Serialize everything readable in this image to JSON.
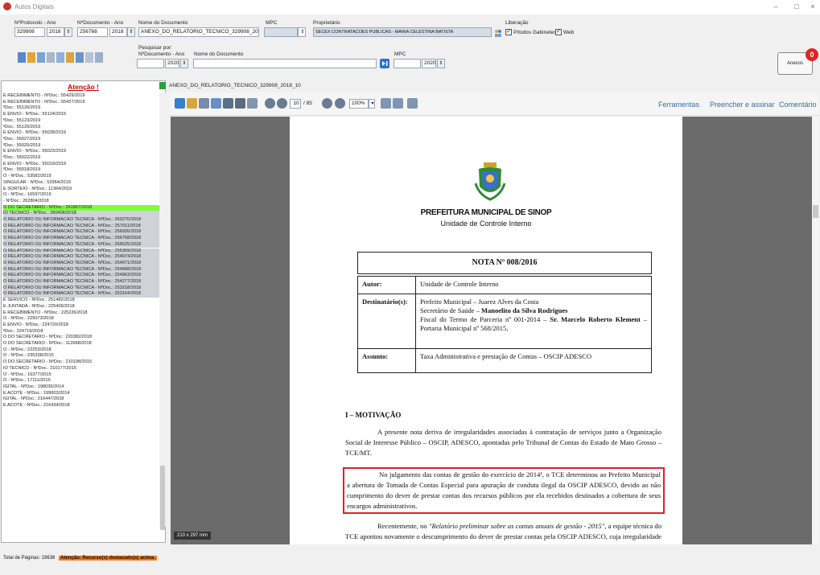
{
  "window": {
    "title": "Autos Digitais",
    "minimize": "–",
    "maximize": "□",
    "close": "×"
  },
  "form": {
    "protocolo_label": "NºProtocolo - Ano",
    "protocolo_value": "329908",
    "protocolo_year": "2018",
    "documento_label": "NºDocumento - Ano",
    "documento_value": "256768",
    "documento_year": "2018",
    "nome_label": "Nome do Documento",
    "nome_value": "ANEXO_DO_RELATORIO_TECNICO_329908_2018_10",
    "mpc_label": "MPC",
    "proprietario_label": "Proprietário",
    "proprietario_value": "SECEX CONTRATACOES PUBLICAS - MARIA CELESTINA BATISTA",
    "liberacao_label": "Liberação",
    "ptodos_label": "P/todos Gabinetes",
    "web_label": "Web",
    "pesquisar_label": "Pesquisar por:",
    "search_doc_label": "NºDocumento - Ano",
    "search_doc_year": "2020",
    "search_nome_label": "Nome do Documento",
    "search_mpc_label": "MPC",
    "search_mpc_year": "2020"
  },
  "anexos": {
    "label": "Anexos",
    "count": "0"
  },
  "left": {
    "header": "Atenção !",
    "items": [
      "E RECEBIMENTO - NºDoc.: 55429/2019",
      "E RECEBIMENTO - NºDoc.: 55427/2019",
      "ºDoc.: 55126/2019",
      "E ENVIO - NºDoc.: 55124/2019",
      "ºDoc.: 55123/2019",
      "ºDoc.: 55120/2019",
      "E ENVIO - NºDoc.: 55028/2019",
      "ºDoc.: 55027/2019",
      "ºDoc.: 55025/2019",
      "E ENVIO - NºDoc.: 55023/2019",
      "ºDoc.: 55022/2019",
      "E ENVIO - NºDoc.: 55019/2019",
      "ºDoc.: 55018/2019",
      "O - NºDoc.: 53582/2019",
      "SINGULAR - NºDoc.: 53364/2019",
      "E SORTEIO - NºDoc.: 11364/2019",
      "O - NºDoc.: 16597/2019",
      "- NºDoc.: 262804/2018",
      "O DO SECRETARIO - NºDoc.: 261867/2018",
      "IO TECNICO - NºDoc.: 260406/2018",
      "O RELATORIO OU INFORMACAO TECNICA - NºDoc.: 260270/2018",
      "O RELATORIO OU INFORMACAO TECNICA - NºDoc.: 257011/2018",
      "O RELATORIO OU INFORMACAO TECNICA - NºDoc.: 256926/2018",
      "O RELATORIO OU INFORMACAO TECNICA - NºDoc.: 256768/2018",
      "O RELATORIO OU INFORMACAO TECNICA - NºDoc.: 256625/2018",
      "O RELATORIO OU INFORMACAO TECNICA - NºDoc.: 255369/2018",
      "O RELATORIO OU INFORMACAO TECNICA - NºDoc.: 254974/2018",
      "O RELATORIO OU INFORMACAO TECNICA - NºDoc.: 254971/2018",
      "O RELATORIO OU INFORMACAO TECNICA - NºDoc.: 254968/2018",
      "O RELATORIO OU INFORMACAO TECNICA - NºDoc.: 254963/2018",
      "O RELATORIO OU INFORMACAO TECNICA - NºDoc.: 254277/2018",
      "O RELATORIO OU INFORMACAO TECNICA - NºDoc.: 253218/2018",
      "O RELATORIO OU INFORMACAO TECNICA - NºDoc.: 253164/2018",
      "E SERVICO - NºDoc.: 251482/2018",
      "E JUNTADA - NºDoc.: 225406/2018",
      "E RECEBIMENTO - NºDoc.: 225226/2018",
      "O - NºDoc.: 225073/2018",
      "E ENVIO - NºDoc.: 224720/2018",
      "ºDoc.: 224719/2018",
      "O DO SECRETARIO - NºDoc.: 220382/2018",
      "O DO SECRETARIO - NºDoc.: 112668/2018",
      "O - NºDoc.: 22253/2018",
      "O - NºDoc.: 235338/2015",
      "O DO SECRETARIO - NºDoc.: 210198/2015",
      "IO TECNICO - NºDoc.: 210177/2015",
      "O - NºDoc.: 16377/2015",
      "O - NºDoc.: 17111/2015",
      "IGITAL - NºDoc.: 198035/2014",
      "E ACOTE - NºDoc.: 199003/2014",
      "IGITAL - NºDoc.: 216447/2018",
      "E ACOTE - NºDoc.: 216434/2018"
    ]
  },
  "doc": {
    "name": "ANEXO_DO_RELATORIO_TECNICO_329908_2018_10"
  },
  "pdf": {
    "page_current": "10",
    "page_total": "/ 85",
    "zoom": "100%",
    "tools_label": "Ferramentas",
    "fill_sign_label": "Preencher e assinar",
    "comment_label": "Comentário",
    "size_badge": "210 x 297 mm"
  },
  "page": {
    "org": "PREFEITURA MUNICIPAL DE SINOP",
    "unit": "Unidade de Controle Interno",
    "nota": "NOTA Nº 008/2016",
    "autor_label": "Autor:",
    "autor_value": "Unidade de Controle Interno",
    "dest_label": "Destinatário(s):",
    "dest_line1": "Prefeito Municipal – Juarez Alves da Costa",
    "dest_line2a": "Secretário de Saúde – ",
    "dest_line2b": "Manoelito da Silva Rodrigues",
    "dest_line3a": "Fiscal do Termo de Parceria nº 001-2014 – ",
    "dest_line3b": "Sr. Marcelo Roberto Klement",
    "dest_line3c": " – Portaria Municipal nº 568/2015,",
    "assunto_label": "Assunto:",
    "assunto_value": "Taxa Administrativa e prestação de Contas – OSCIP ADESCO",
    "section": "I – MOTIVAÇÃO",
    "p1": "A presente nota deriva de irregularidades associadas à contratação de serviços junto a Organização Social de Interesse Público – OSCIP, ADESCO, apontadas pelo Tribunal de Contas do Estado de Mato Grosso – TCE/MT.",
    "p2": "No julgamento das contas de gestão do exercício de 2014¹, o TCE determinou ao Prefeito Municipal a abertura de Tomada de Contas Especial para apuração de conduta ilegal da OSCIP ADESCO, devido ao não cumprimento do dever de prestar contas dos recursos públicos por ela recebidos destinados a cobertura de seus encargos administrativos.",
    "p3a": "Recentemente, no ",
    "p3b": "\"Relatório preliminar sobre as contas anuais de gestão - 2015\"",
    "p3c": ", a equipe técnica do TCE apontou novamente o descumprimento do dever de prestar contas pela OSCIP ADESCO, cuja irregularidade continua sendo objeto de apuração."
  },
  "status": {
    "total": "Total de Páginas: 19638",
    "alert": "Atenção: Recurso(s) destacado(s) acima."
  }
}
